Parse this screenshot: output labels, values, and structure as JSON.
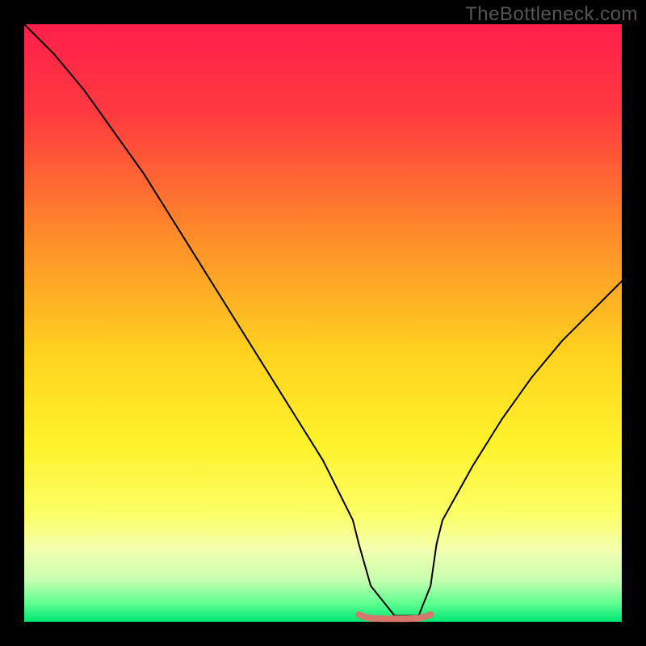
{
  "watermark": "TheBottleneck.com",
  "chart_data": {
    "type": "line",
    "title": "",
    "xlabel": "",
    "ylabel": "",
    "xlim": [
      0,
      100
    ],
    "ylim": [
      0,
      100
    ],
    "background_gradient": {
      "stops": [
        {
          "offset": 0.0,
          "color": "#ff1f4b"
        },
        {
          "offset": 0.15,
          "color": "#ff3a3f"
        },
        {
          "offset": 0.35,
          "color": "#ff8a2a"
        },
        {
          "offset": 0.55,
          "color": "#ffd21f"
        },
        {
          "offset": 0.7,
          "color": "#fff22a"
        },
        {
          "offset": 0.82,
          "color": "#fcff66"
        },
        {
          "offset": 0.88,
          "color": "#f3ffb0"
        },
        {
          "offset": 0.93,
          "color": "#c8ffb0"
        },
        {
          "offset": 0.97,
          "color": "#5cff8f"
        },
        {
          "offset": 1.0,
          "color": "#00e574"
        }
      ]
    },
    "series": [
      {
        "name": "bottleneck-curve",
        "color": "#000000",
        "width": 2,
        "x": [
          0,
          5,
          10,
          15,
          20,
          25,
          30,
          35,
          40,
          45,
          50,
          55,
          56,
          58,
          62,
          66,
          68,
          69,
          70,
          75,
          80,
          85,
          90,
          95,
          100
        ],
        "y": [
          100,
          95,
          89,
          82,
          75,
          67,
          59,
          51,
          43,
          35,
          27,
          17,
          13,
          6,
          1,
          1,
          6,
          13,
          17,
          26,
          34,
          41,
          47,
          52,
          57
        ]
      },
      {
        "name": "flat-minimum-marker",
        "color": "#d9766b",
        "width": 8,
        "x": [
          56,
          57,
          58,
          60,
          62,
          64,
          66,
          67,
          68
        ],
        "y": [
          1.2,
          0.8,
          0.6,
          0.5,
          0.5,
          0.5,
          0.6,
          0.8,
          1.2
        ]
      }
    ]
  }
}
